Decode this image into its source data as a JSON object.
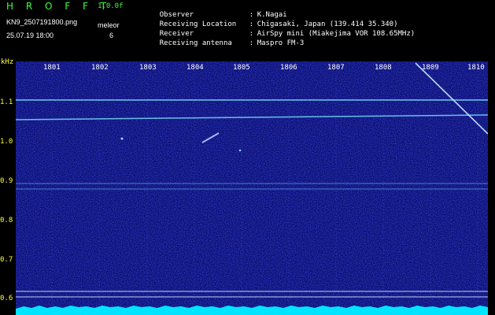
{
  "header": {
    "app_title": "H R O F F T",
    "version": "1.0.0f",
    "file_name": "KN9_2507191800.png",
    "date_time": "25.07.19 18:00",
    "meleor_label": "meleor",
    "meleor_count": "6"
  },
  "info": [
    {
      "key": "Observer",
      "sep": ":",
      "value": "K.Nagai"
    },
    {
      "key": "Receiving Location",
      "sep": ":",
      "value": "Chigasaki, Japan (139.414 35.340)"
    },
    {
      "key": "Receiver",
      "sep": ":",
      "value": "AirSpy mini (Miakejima VOR 108.65MHz)"
    },
    {
      "key": "Receiving antenna",
      "sep": ":",
      "value": "Maspro FM-3"
    }
  ],
  "axis": {
    "y_unit": "kHz",
    "y_ticks": [
      "1.1",
      "1.0",
      "0.9",
      "0.8",
      "0.7",
      "0.6"
    ],
    "x_ticks": [
      "1801",
      "1802",
      "1803",
      "1804",
      "1805",
      "1806",
      "1807",
      "1808",
      "1809",
      "1810"
    ]
  },
  "colors": {
    "background": "#000000",
    "spectrogram_bg": "#0a0c6e",
    "axis_label": "#ffff40",
    "title_green": "#3cff3c",
    "signal_line": "#7fe8ff",
    "noise_floor": "#00e5ff"
  }
}
